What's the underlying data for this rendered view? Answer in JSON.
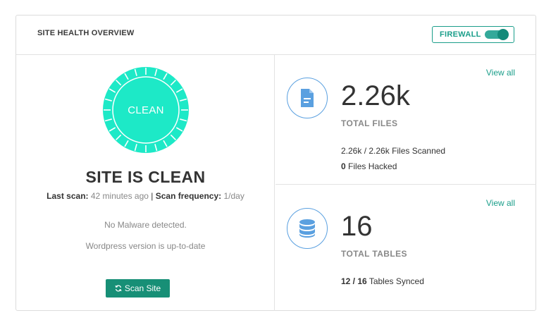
{
  "header": {
    "title": "SITE HEALTH OVERVIEW",
    "firewall_label": "FIREWALL",
    "firewall_enabled": true
  },
  "status": {
    "ring_text": "CLEAN",
    "headline": "SITE IS CLEAN",
    "last_scan_label": "Last scan:",
    "last_scan_value": "42 minutes ago",
    "separator": "|",
    "frequency_label": "Scan frequency:",
    "frequency_value": "1/day",
    "notes": [
      "No Malware detected.",
      "Wordpress version is up-to-date"
    ],
    "scan_button_label": "Scan Site",
    "ring_color": "#1de9c7"
  },
  "files": {
    "view_all": "View all",
    "value": "2.26k",
    "label": "TOTAL FILES",
    "scanned_count": "2.26k / 2.26k",
    "scanned_text": "Files Scanned",
    "hacked_count": "0",
    "hacked_text": "Files Hacked",
    "icon": "file-icon"
  },
  "tables": {
    "view_all": "View all",
    "value": "16",
    "label": "TOTAL TABLES",
    "synced_count": "12 / 16",
    "synced_text": "Tables Synced",
    "icon": "database-icon"
  },
  "colors": {
    "accent": "#1a9e8a",
    "button": "#178f76",
    "icon_blue": "#5aa0e0"
  }
}
